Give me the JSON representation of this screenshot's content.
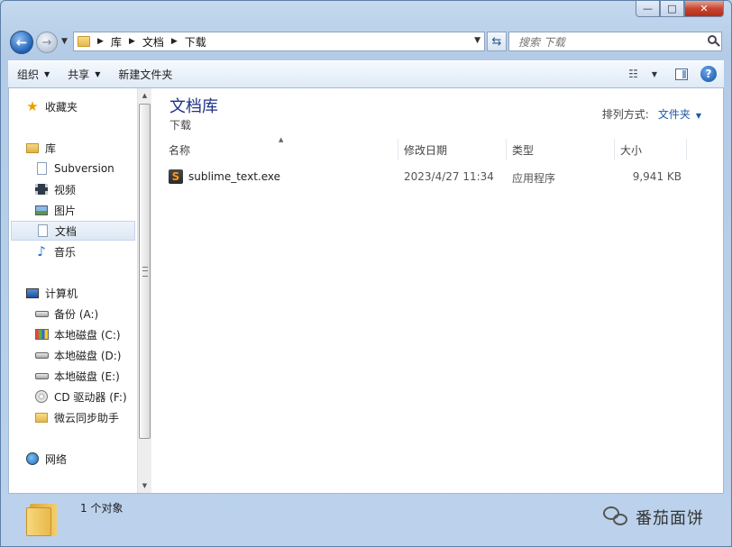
{
  "window": {
    "controls": {
      "minimize": "—",
      "maximize": "□",
      "close": "✕"
    }
  },
  "address_bar": {
    "crumbs": [
      "库",
      "文档",
      "下载"
    ],
    "search_placeholder": "搜索 下载"
  },
  "toolbar": {
    "organize": "组织",
    "share": "共享",
    "new_folder": "新建文件夹"
  },
  "nav": {
    "favorites": "收藏夹",
    "libraries": "库",
    "subversion": "Subversion",
    "videos": "视频",
    "pictures": "图片",
    "documents": "文档",
    "music": "音乐",
    "computer": "计算机",
    "backup": "备份 (A:)",
    "disk_c": "本地磁盘 (C:)",
    "disk_d": "本地磁盘 (D:)",
    "disk_e": "本地磁盘 (E:)",
    "cd_drive": "CD 驱动器 (F:)",
    "weiyun": "微云同步助手",
    "network": "网络"
  },
  "library": {
    "title": "文档库",
    "subtitle": "下载",
    "arrange_label": "排列方式:",
    "arrange_value": "文件夹"
  },
  "columns": {
    "name": "名称",
    "modified": "修改日期",
    "type": "类型",
    "size": "大小"
  },
  "files": [
    {
      "name": "sublime_text.exe",
      "modified": "2023/4/27 11:34",
      "type": "应用程序",
      "size": "9,941 KB"
    }
  ],
  "status": {
    "count": "1 个对象"
  },
  "watermark": {
    "text": "番茄面饼"
  },
  "colors": {
    "library_title": "#1e3287",
    "link": "#1e5aa8",
    "close_button": "#c7452f"
  }
}
